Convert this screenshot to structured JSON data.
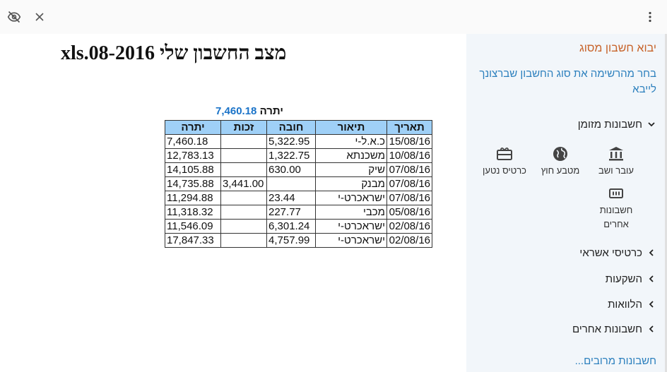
{
  "toolbar": {
    "hide_icon": "eye-off-icon",
    "close_icon": "close-icon",
    "menu_icon": "more-vert-icon"
  },
  "document": {
    "title": "מצב החשבון שלי xls.08-2016",
    "balance_label": "יתרה",
    "balance_value": "7,460.18",
    "columns": [
      "תאריך",
      "תיאור",
      "חובה",
      "זכות",
      "יתרה"
    ],
    "rows": [
      [
        "15/08/16",
        "כ.א.ל-י",
        "5,322.95",
        "",
        "7,460.18"
      ],
      [
        "10/08/16",
        "משכנתא",
        "1,322.75",
        "",
        "12,783.13"
      ],
      [
        "07/08/16",
        "שיק",
        "630.00",
        "",
        "14,105.88"
      ],
      [
        "07/08/16",
        "מבנק",
        "",
        "3,441.00",
        "14,735.88"
      ],
      [
        "07/08/16",
        "ישראכרט-י",
        "23.44",
        "",
        "11,294.88"
      ],
      [
        "05/08/16",
        "מכבי",
        "227.77",
        "",
        "11,318.32"
      ],
      [
        "02/08/16",
        "ישראכרט-י",
        "6,301.24",
        "",
        "11,546.09"
      ],
      [
        "02/08/16",
        "ישראכרט-י",
        "4,757.99",
        "",
        "17,847.33"
      ]
    ]
  },
  "sidebar": {
    "title": "יבוא חשבון מסוג",
    "description": "בחר מהרשימה את סוג החשבון שברצונך לייבא",
    "section_cash": "חשבונות מזומן",
    "tiles": [
      {
        "label": "עובר ושב",
        "icon": "bank-icon"
      },
      {
        "label": "מטבע חוץ",
        "icon": "globe-icon"
      },
      {
        "label": "כרטיס נטען",
        "icon": "gift-card-icon"
      },
      {
        "label": "חשבונות אחרים",
        "icon": "counter-icon"
      }
    ],
    "section_credit": "כרטיסי אשראי",
    "section_investments": "השקעות",
    "section_loans": "הלוואות",
    "section_other": "חשבונות אחרים",
    "more_link": "חשבונות מרובים..."
  }
}
